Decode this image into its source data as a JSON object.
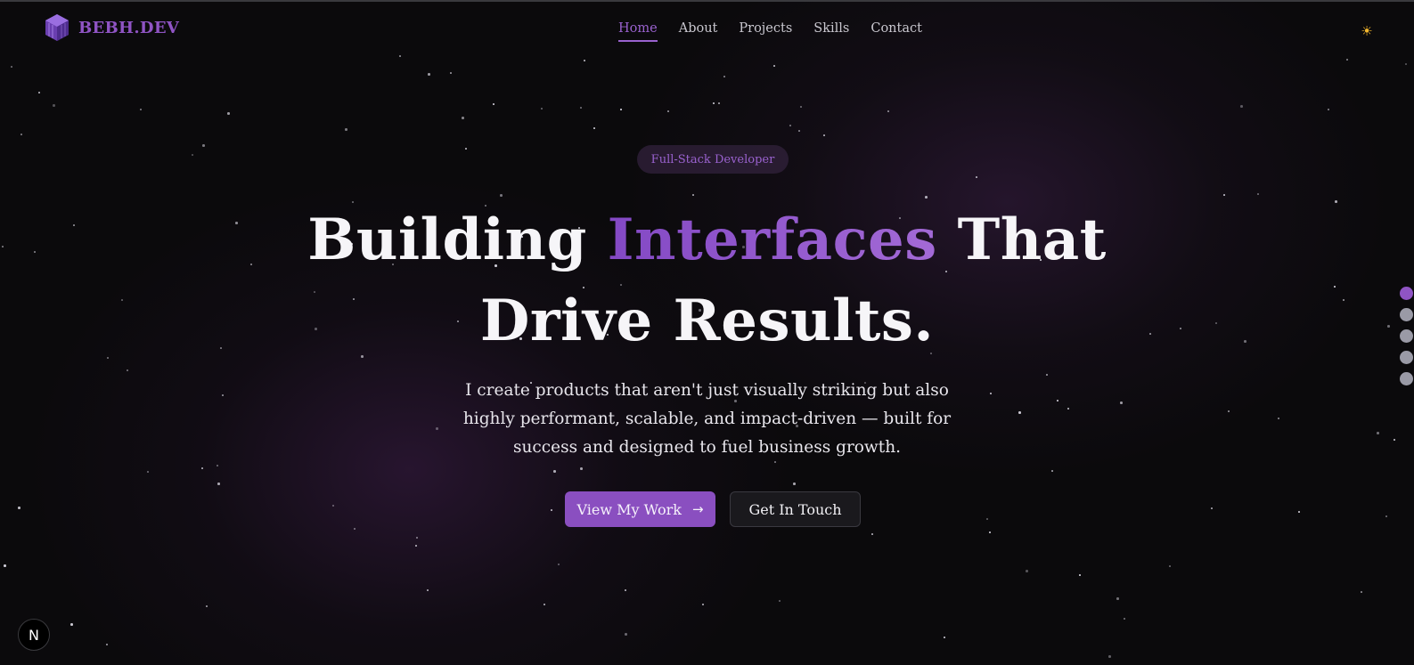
{
  "brand": {
    "name": "BEBH.DEV",
    "icon": "cube-logo-icon",
    "accent_color": "#8f54c4"
  },
  "nav": {
    "items": [
      {
        "label": "Home",
        "active": true
      },
      {
        "label": "About",
        "active": false
      },
      {
        "label": "Projects",
        "active": false
      },
      {
        "label": "Skills",
        "active": false
      },
      {
        "label": "Contact",
        "active": false
      }
    ],
    "theme_toggle_icon": "sun-icon",
    "theme_toggle_glyph": "☀"
  },
  "hero": {
    "badge": "Full-Stack Developer",
    "headline_part1": "Building",
    "headline_accent": "Interfaces",
    "headline_part2": "That Drive Results.",
    "subtitle": "I create products that aren't just visually striking but also highly performant, scalable, and impact-driven — built for success and designed to fuel business growth.",
    "primary_button": {
      "label": "View My Work",
      "icon": "arrow-right-icon",
      "glyph": "→"
    },
    "secondary_button": {
      "label": "Get In Touch"
    }
  },
  "section_indicator": {
    "count": 5,
    "active_index": 0
  },
  "dev_badge": {
    "glyph": "N",
    "icon": "nextjs-icon"
  },
  "colors": {
    "background": "#0b0a0c",
    "accent": "#8f54c4",
    "text": "#f6f5f8",
    "sun": "#f5b82e"
  }
}
